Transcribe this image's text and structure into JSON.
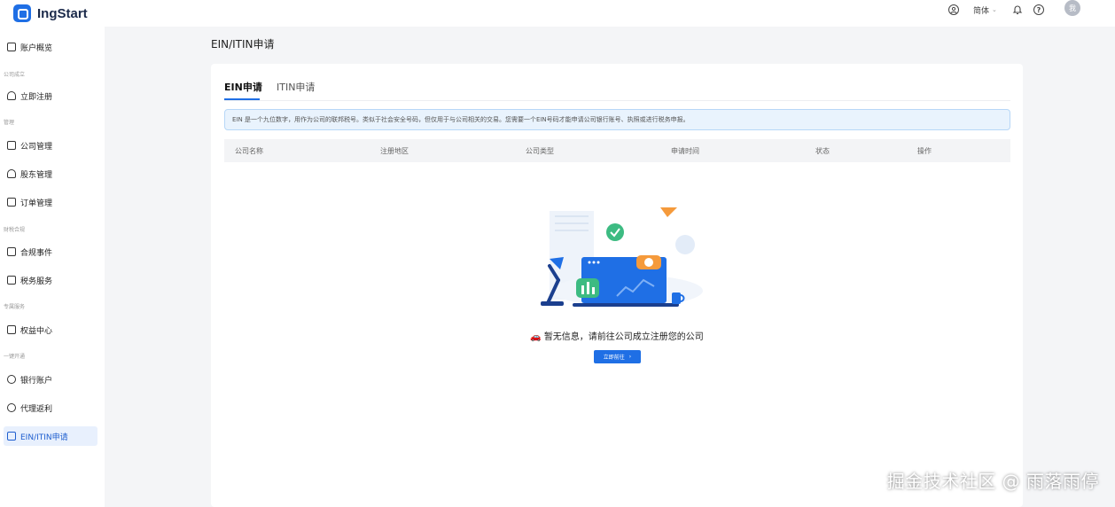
{
  "app": {
    "name": "IngStart"
  },
  "header": {
    "language": "简体",
    "avatar_text": "我"
  },
  "sidebar": {
    "items": [
      {
        "label": "账户概览"
      },
      {
        "group": "公司成立"
      },
      {
        "label": "立即注册"
      },
      {
        "group": "管理"
      },
      {
        "label": "公司管理"
      },
      {
        "label": "股东管理"
      },
      {
        "label": "订单管理"
      },
      {
        "group": "财税合规"
      },
      {
        "label": "合规事件"
      },
      {
        "label": "税务服务"
      },
      {
        "group": "专属服务"
      },
      {
        "label": "权益中心"
      },
      {
        "group": "一键开通"
      },
      {
        "label": "银行账户"
      },
      {
        "label": "代理返利"
      },
      {
        "label": "EIN/ITIN申请"
      }
    ]
  },
  "page": {
    "title": "EIN/ITIN申请"
  },
  "tabs": [
    {
      "label": "EIN申请"
    },
    {
      "label": "ITIN申请"
    }
  ],
  "info_banner": "EIN 是一个九位数字，用作为公司的联邦税号。类似于社会安全号码，但仅用于与公司相关的交易。您需要一个EIN号码才能申请公司银行账号、执照或进行税务申报。",
  "table": {
    "columns": [
      "公司名称",
      "注册地区",
      "公司类型",
      "申请时间",
      "状态",
      "操作"
    ]
  },
  "empty_state": {
    "emoji": "🚗",
    "message": "暂无信息，请前往公司成立注册您的公司",
    "button_label": "立即前往"
  },
  "watermark": "掘金技术社区 @ 雨落雨停",
  "colors": {
    "accent": "#1f6fe5",
    "info_bg": "#e9f3fd",
    "active_menu_bg": "#e8f0fd"
  }
}
